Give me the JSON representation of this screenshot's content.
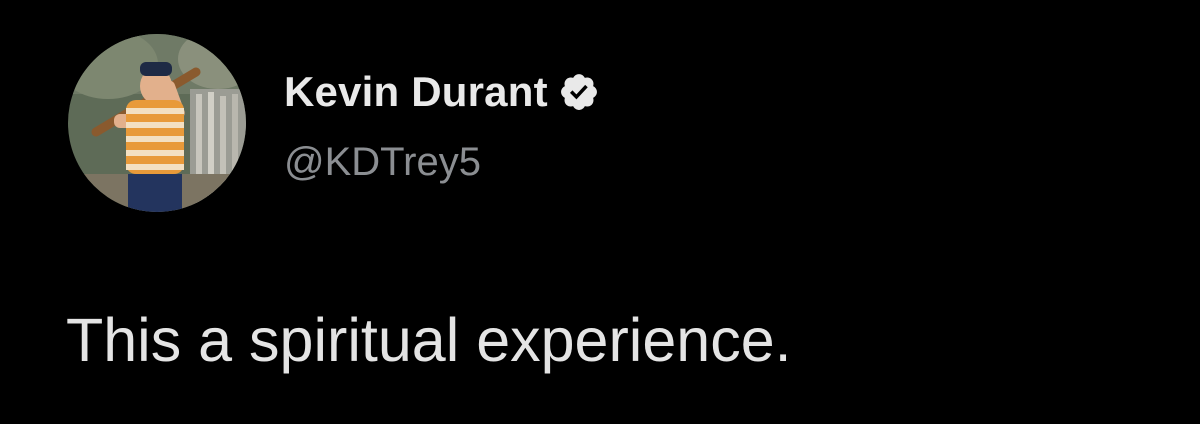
{
  "author": {
    "display_name": "Kevin Durant",
    "handle": "@KDTrey5",
    "verified": true,
    "verified_icon": "verified-badge-icon",
    "avatar": "profile-photo"
  },
  "tweet": {
    "text": "This a spiritual experience."
  },
  "colors": {
    "background": "#000000",
    "name": "#e9e9e9",
    "handle": "#8b8e92",
    "text": "#e4e4e4"
  }
}
